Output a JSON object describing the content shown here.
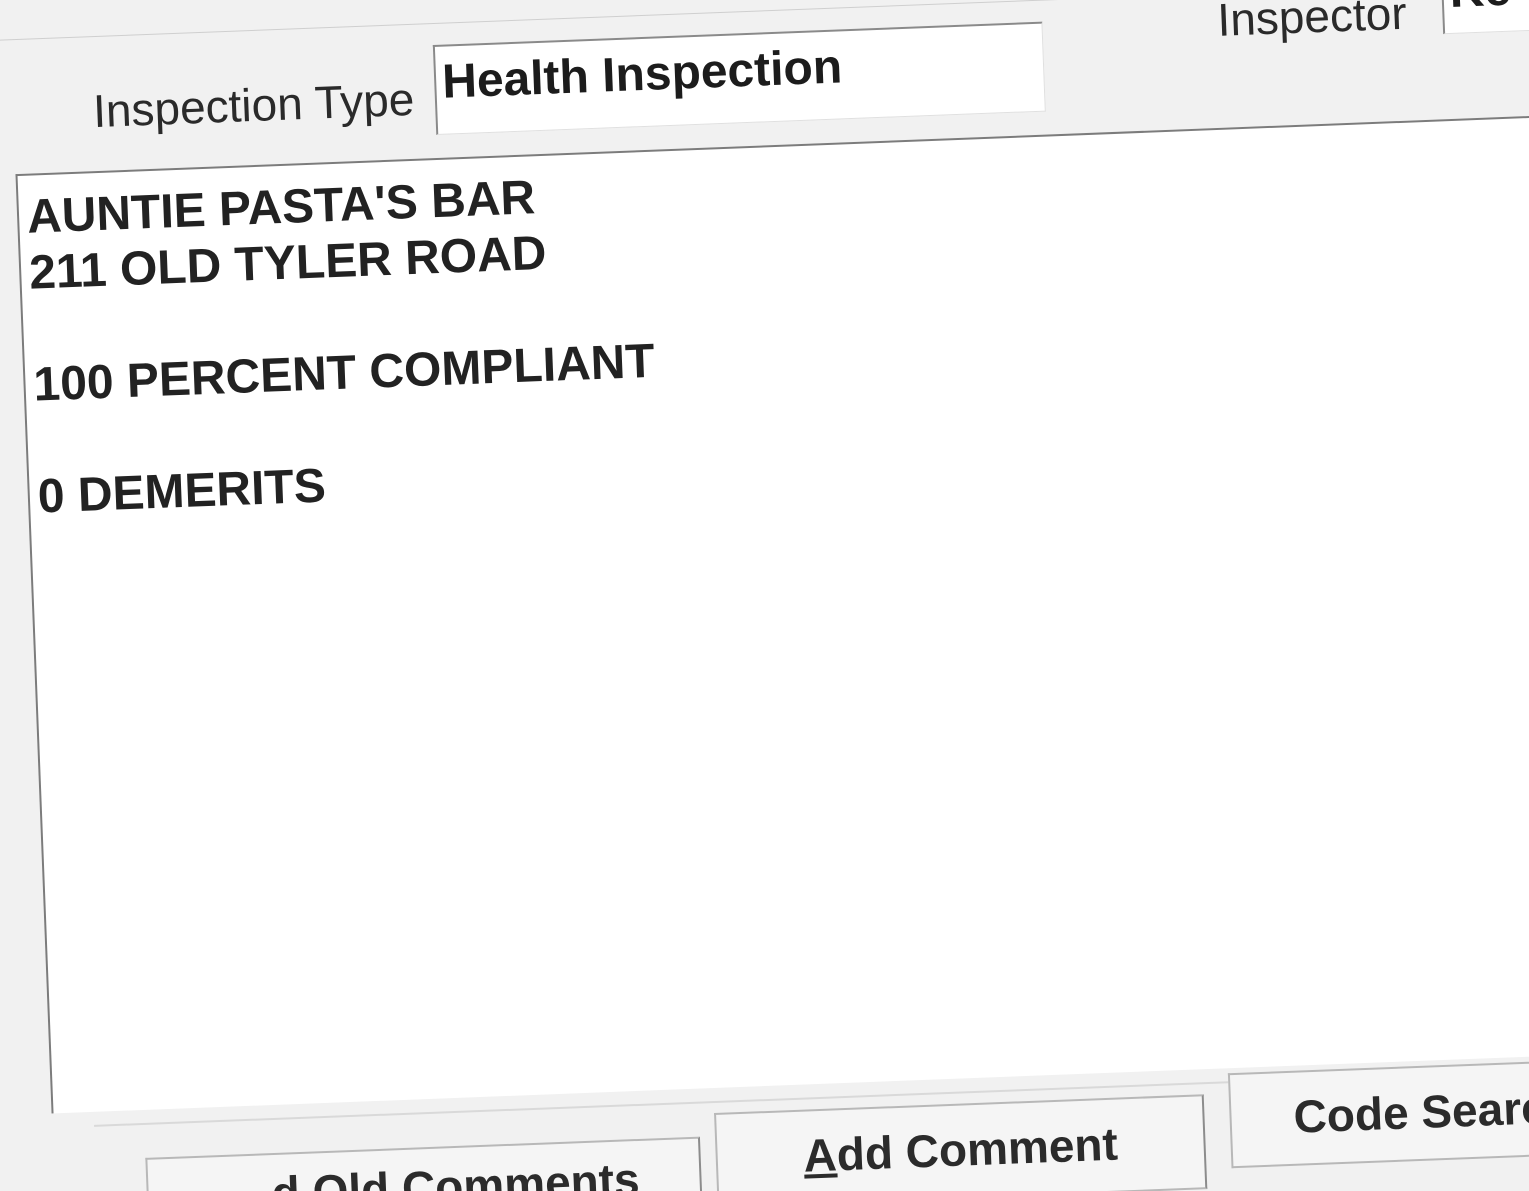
{
  "header": {
    "inspection_type_label": "Inspection Type",
    "inspection_type_value": "Health Inspection",
    "inspector_label": "Inspector",
    "inspector_value": "Ke"
  },
  "comments": {
    "lines": [
      "AUNTIE PASTA'S BAR",
      "211 OLD TYLER ROAD",
      "",
      "100 PERCENT COMPLIANT",
      "",
      "0 DEMERITS"
    ]
  },
  "buttons": {
    "old_comments_label": "d Old Comments",
    "add_comment_mnemonic": "A",
    "add_comment_rest": "dd Comment",
    "code_search_label": "Code Search"
  }
}
